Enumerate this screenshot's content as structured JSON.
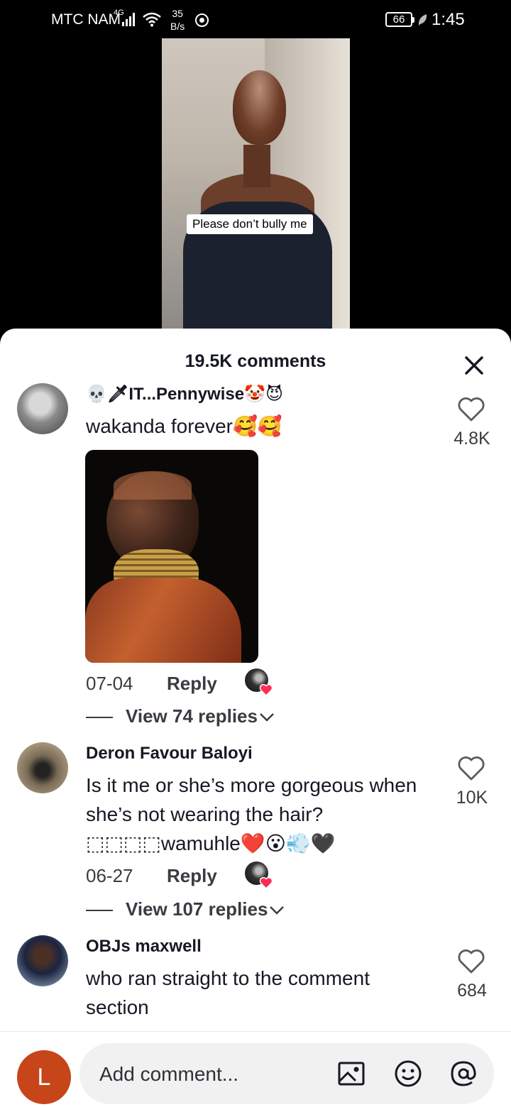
{
  "status_bar": {
    "carrier": "MTC NAM",
    "network": "4G",
    "speed_value": "35",
    "speed_unit": "B/s",
    "battery": "66",
    "time": "1:45"
  },
  "video": {
    "caption": "Please don’t bully me"
  },
  "comments_sheet": {
    "title": "19.5K comments",
    "comments": [
      {
        "username": "💀🗡IT...Pennywise🤡😈",
        "text": "wakanda forever🥰🥰",
        "has_photo": true,
        "date": "07-04",
        "reply_label": "Reply",
        "likes": "4.8K",
        "view_replies": "View 74 replies"
      },
      {
        "username": "Deron Favour Baloyi",
        "text": "Is it me or she’s more gorgeous when she’s not wearing the hair?⬚⬚⬚⬚wamuhle❤️😮💨🖤",
        "date": "06-27",
        "reply_label": "Reply",
        "likes": "10K",
        "view_replies": "View 107 replies"
      },
      {
        "username": "OBJs maxwell",
        "text": "who ran straight to the comment section",
        "likes": "684"
      }
    ]
  },
  "composer": {
    "avatar_letter": "L",
    "placeholder": "Add comment..."
  },
  "colors": {
    "like_heart_badge": "#fe2c55",
    "user_avatar": "#c6461a",
    "input_bg": "#f1f1f2"
  },
  "icons": [
    "close-icon",
    "heart-outline-icon",
    "image-icon",
    "emoji-icon",
    "at-mention-icon",
    "chevron-down-icon"
  ]
}
